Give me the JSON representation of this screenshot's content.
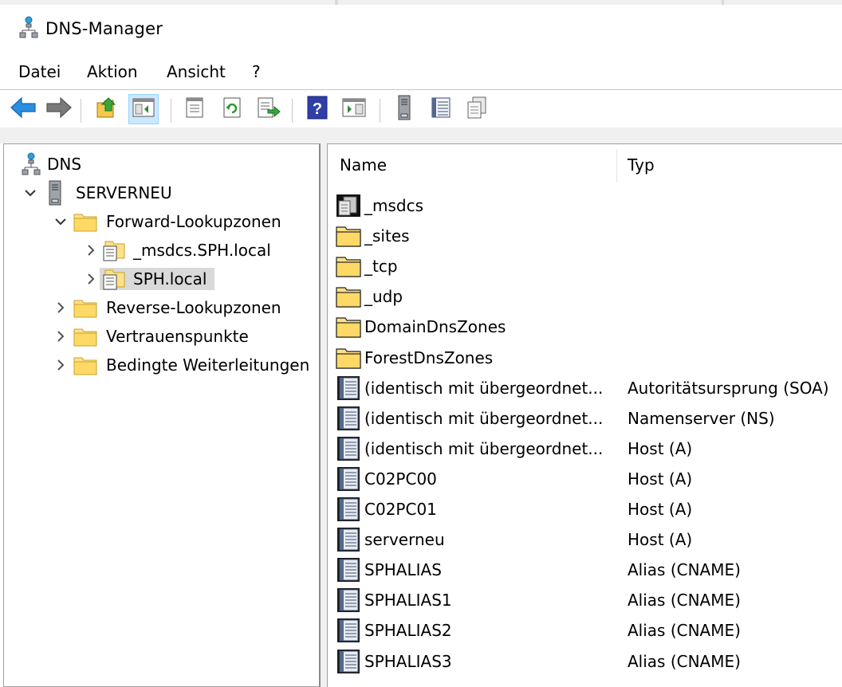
{
  "window": {
    "title": "DNS-Manager"
  },
  "menu": [
    "Datei",
    "Aktion",
    "Ansicht",
    "?"
  ],
  "toolbar": {
    "buttons": [
      {
        "icon": "back-arrow-icon"
      },
      {
        "icon": "forward-arrow-icon"
      },
      {
        "icon": "up-folder-icon"
      },
      {
        "icon": "show-hide-console-tree-icon"
      },
      {
        "icon": "properties-icon"
      },
      {
        "icon": "refresh-icon"
      },
      {
        "icon": "export-list-icon"
      },
      {
        "icon": "help-icon"
      },
      {
        "icon": "show-hide-action-pane-icon"
      },
      {
        "icon": "server-icon"
      },
      {
        "icon": "record-list-icon"
      },
      {
        "icon": "copy-icon"
      }
    ]
  },
  "tree": {
    "items": [
      {
        "label": "DNS",
        "icon": "dns-root-icon",
        "chevron": "none",
        "level": 0
      },
      {
        "label": "SERVERNEU",
        "icon": "server-icon",
        "chevron": "expanded",
        "level": 1
      },
      {
        "label": "Forward-Lookupzonen",
        "icon": "folder-icon",
        "chevron": "expanded",
        "level": 2
      },
      {
        "label": "_msdcs.SPH.local",
        "icon": "zone-icon",
        "chevron": "collapsed",
        "level": 3
      },
      {
        "label": "SPH.local",
        "icon": "zone-icon",
        "chevron": "collapsed",
        "level": 3,
        "selected": true
      },
      {
        "label": "Reverse-Lookupzonen",
        "icon": "folder-icon",
        "chevron": "collapsed",
        "level": 2
      },
      {
        "label": "Vertrauenspunkte",
        "icon": "folder-icon",
        "chevron": "collapsed",
        "level": 2
      },
      {
        "label": "Bedingte Weiterleitungen",
        "icon": "folder-icon",
        "chevron": "collapsed",
        "level": 2
      }
    ]
  },
  "list": {
    "columns": [
      "Name",
      "Typ"
    ],
    "rows": [
      {
        "name": "_msdcs",
        "type": "",
        "icon": "delegated-zone-icon"
      },
      {
        "name": "_sites",
        "type": "",
        "icon": "folder-icon"
      },
      {
        "name": "_tcp",
        "type": "",
        "icon": "folder-icon"
      },
      {
        "name": "_udp",
        "type": "",
        "icon": "folder-icon"
      },
      {
        "name": "DomainDnsZones",
        "type": "",
        "icon": "folder-icon"
      },
      {
        "name": "ForestDnsZones",
        "type": "",
        "icon": "folder-icon"
      },
      {
        "name": "(identisch mit übergeordnet...",
        "type": "Autoritätsursprung (SOA)",
        "icon": "record-icon"
      },
      {
        "name": "(identisch mit übergeordnet...",
        "type": "Namenserver (NS)",
        "icon": "record-icon"
      },
      {
        "name": "(identisch mit übergeordnet...",
        "type": "Host (A)",
        "icon": "record-icon"
      },
      {
        "name": "C02PC00",
        "type": "Host (A)",
        "icon": "record-icon"
      },
      {
        "name": "C02PC01",
        "type": "Host (A)",
        "icon": "record-icon"
      },
      {
        "name": "serverneu",
        "type": "Host (A)",
        "icon": "record-icon"
      },
      {
        "name": "SPHALIAS",
        "type": "Alias (CNAME)",
        "icon": "record-icon"
      },
      {
        "name": "SPHALIAS1",
        "type": "Alias (CNAME)",
        "icon": "record-icon"
      },
      {
        "name": "SPHALIAS2",
        "type": "Alias (CNAME)",
        "icon": "record-icon"
      },
      {
        "name": "SPHALIAS3",
        "type": "Alias (CNAME)",
        "icon": "record-icon"
      }
    ]
  },
  "colors": {
    "selection": "#d9d9d9",
    "toolbar_active": "#cce8ff",
    "folder": "#ffd966",
    "arrow_blue": "#1e90e0"
  }
}
